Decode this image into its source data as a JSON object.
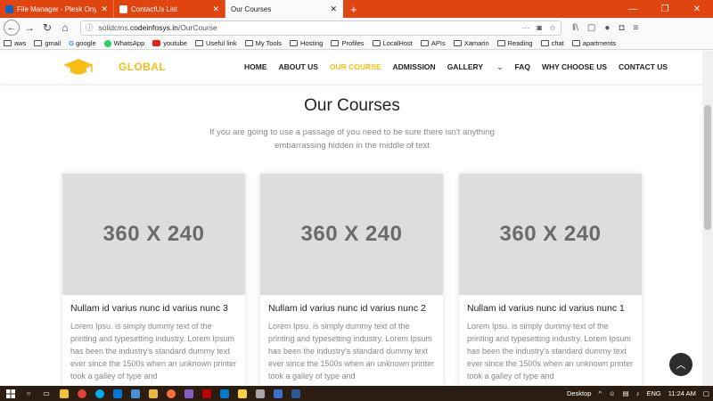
{
  "browser": {
    "tabs": [
      {
        "label": "File Manager - Plesk Onyx 17.8",
        "favicon_color": "#0a66c2"
      },
      {
        "label": "ContactUs List",
        "favicon_color": "#e1450f"
      },
      {
        "label": "Our Courses",
        "favicon_color": ""
      }
    ],
    "new_tab": "+",
    "url_prefix": "solidcms.",
    "url_domain": "codeinfosys.in",
    "url_path": "/OurCourse",
    "accent_color": "#e1450f"
  },
  "bookmarks": [
    {
      "label": "aws",
      "icon": "folder-icon"
    },
    {
      "label": "gmail",
      "icon": "folder-icon"
    },
    {
      "label": "google",
      "icon": "google-icon"
    },
    {
      "label": "WhatsApp",
      "icon": "whatsapp-icon"
    },
    {
      "label": "youtube",
      "icon": "youtube-icon"
    },
    {
      "label": "Useful link",
      "icon": "folder-icon"
    },
    {
      "label": "My Tools",
      "icon": "folder-icon"
    },
    {
      "label": "Hosting",
      "icon": "folder-icon"
    },
    {
      "label": "Profiles",
      "icon": "folder-icon"
    },
    {
      "label": "LocalHost",
      "icon": "folder-icon"
    },
    {
      "label": "APIs",
      "icon": "folder-icon"
    },
    {
      "label": "Xamarin",
      "icon": "folder-icon"
    },
    {
      "label": "Reading",
      "icon": "folder-icon"
    },
    {
      "label": "chat",
      "icon": "folder-icon"
    },
    {
      "label": "apartments",
      "icon": "folder-icon"
    }
  ],
  "site": {
    "brand": "GLOBAL",
    "brand_color": "#f7be16",
    "menu": [
      {
        "label": "HOME",
        "active": false
      },
      {
        "label": "ABOUT US",
        "active": false
      },
      {
        "label": "OUR COURSE",
        "active": true
      },
      {
        "label": "ADMISSION",
        "active": false
      },
      {
        "label": "GALLERY",
        "active": false,
        "has_dropdown": true
      },
      {
        "label": "FAQ",
        "active": false
      },
      {
        "label": "WHY CHOOSE US",
        "active": false
      },
      {
        "label": "CONTACT US",
        "active": false
      }
    ]
  },
  "main": {
    "title": "Our Courses",
    "subtitle": "If you are going to use a passage of you need to be sure there isn't anything embarrassing hidden in the middle of text",
    "cards": [
      {
        "image_label": "360 X 240",
        "title": "Nullam id varius nunc id varius nunc 3",
        "text": "Lorem Ipsu. is simply dummy text of the printing and typesetting industry. Lorem Ipsum has been the industry's standard dummy text ever since the 1500s when an unknown printer took a galley of type and"
      },
      {
        "image_label": "360 X 240",
        "title": "Nullam id varius nunc id varius nunc 2",
        "text": "Lorem Ipsu. is simply dummy text of the printing and typesetting industry. Lorem Ipsum has been the industry's standard dummy text ever since the 1500s when an unknown printer took a galley of type and"
      },
      {
        "image_label": "360 X 240",
        "title": "Nullam id varius nunc id varius nunc 1",
        "text": "Lorem Ipsu. is simply dummy text of the printing and typesetting industry. Lorem Ipsum has been the industry's standard dummy text ever since the 1500s when an unknown printer took a galley of type and"
      }
    ]
  },
  "taskbar": {
    "desktop_label": "Desktop",
    "language": "ENG",
    "time": "11:24 AM",
    "apps": [
      "explorer-icon",
      "chrome-icon",
      "skype-icon",
      "edge-icon",
      "mail-icon",
      "folder-icon",
      "firefox-icon",
      "vs-icon",
      "filezilla-icon",
      "vs-code-icon",
      "sticky-notes-icon",
      "sql-icon",
      "vs-blue-icon",
      "terminal-icon"
    ]
  }
}
